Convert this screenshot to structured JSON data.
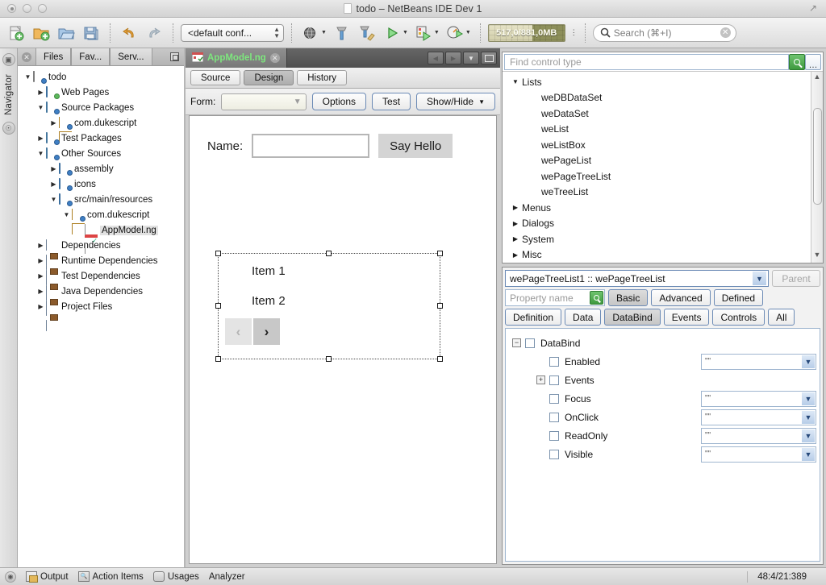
{
  "window": {
    "title": "todo – NetBeans IDE Dev 1",
    "traffic_lights": [
      "close",
      "minimize",
      "zoom"
    ]
  },
  "toolbar": {
    "items": [
      {
        "name": "new-file-icon",
        "label": "New File"
      },
      {
        "name": "new-project-icon",
        "label": "New Project"
      },
      {
        "name": "open-project-icon",
        "label": "Open Project"
      },
      {
        "name": "save-all-icon",
        "label": "Save All"
      },
      {
        "name": "undo-icon",
        "label": "Undo"
      },
      {
        "name": "redo-icon",
        "label": "Redo"
      }
    ],
    "config_combo": "<default conf...",
    "run_group": [
      {
        "name": "set-browser-icon",
        "label": "Set Browser"
      },
      {
        "name": "build-project-icon",
        "label": "Build Project"
      },
      {
        "name": "clean-build-icon",
        "label": "Clean and Build Project"
      },
      {
        "name": "run-project-icon",
        "label": "Run Project"
      },
      {
        "name": "debug-project-icon",
        "label": "Debug Project"
      },
      {
        "name": "profile-project-icon",
        "label": "Profile Project"
      }
    ],
    "memory": "517,0/881,0MB",
    "search_placeholder": "Search (⌘+I)"
  },
  "left_strip": {
    "tabs": [
      "Navigator"
    ]
  },
  "projects_window": {
    "tabs": [
      {
        "label": "Files",
        "active": false
      },
      {
        "label": "Fav...",
        "active": false
      },
      {
        "label": "Serv...",
        "active": false
      }
    ],
    "tree": [
      {
        "indent": 0,
        "twisty": "down",
        "icon": "java-project-icon",
        "label": "todo"
      },
      {
        "indent": 1,
        "twisty": "right",
        "icon": "web-pages-folder-icon",
        "label": "Web Pages"
      },
      {
        "indent": 1,
        "twisty": "down",
        "icon": "source-packages-icon",
        "label": "Source Packages"
      },
      {
        "indent": 2,
        "twisty": "right",
        "icon": "package-icon",
        "label": "com.dukescript"
      },
      {
        "indent": 1,
        "twisty": "right",
        "icon": "test-packages-icon",
        "label": "Test Packages"
      },
      {
        "indent": 1,
        "twisty": "down",
        "icon": "other-sources-icon",
        "label": "Other Sources"
      },
      {
        "indent": 2,
        "twisty": "right",
        "icon": "folder-icon",
        "label": "assembly"
      },
      {
        "indent": 2,
        "twisty": "right",
        "icon": "folder-icon",
        "label": "icons"
      },
      {
        "indent": 2,
        "twisty": "down",
        "icon": "folder-icon",
        "label": "src/main/resources"
      },
      {
        "indent": 3,
        "twisty": "down",
        "icon": "package-icon",
        "label": "com.dukescript"
      },
      {
        "indent": 4,
        "twisty": "none",
        "icon": "ng-file-icon",
        "label": "AppModel.ng",
        "selected": true
      },
      {
        "indent": 1,
        "twisty": "right",
        "icon": "libraries-icon",
        "label": "Dependencies"
      },
      {
        "indent": 1,
        "twisty": "right",
        "icon": "libraries-icon",
        "label": "Runtime Dependencies"
      },
      {
        "indent": 1,
        "twisty": "right",
        "icon": "libraries-icon",
        "label": "Test Dependencies"
      },
      {
        "indent": 1,
        "twisty": "right",
        "icon": "libraries-icon",
        "label": "Java Dependencies"
      },
      {
        "indent": 1,
        "twisty": "right",
        "icon": "project-files-icon",
        "label": "Project Files"
      }
    ]
  },
  "editor": {
    "tab": {
      "label": "AppModel.ng",
      "close": "×"
    },
    "nav_buttons": [
      "◀",
      "▶",
      "▼",
      "maximize"
    ],
    "modes": [
      {
        "label": "Source",
        "active": false
      },
      {
        "label": "Design",
        "active": true
      },
      {
        "label": "History",
        "active": false
      }
    ],
    "formbar": {
      "form_label": "Form:",
      "form_value": "",
      "buttons": [
        {
          "label": "Options",
          "dropdown": false
        },
        {
          "label": "Test",
          "dropdown": false
        },
        {
          "label": "Show/Hide",
          "dropdown": true
        }
      ]
    },
    "canvas": {
      "name_label": "Name:",
      "name_value": "",
      "say_hello_label": "Say Hello",
      "list_items": [
        "Item 1",
        "Item 2"
      ],
      "pager": {
        "prev": "‹",
        "next": "›"
      }
    }
  },
  "palette": {
    "search_placeholder": "Find control type",
    "nodes": [
      {
        "level": "group",
        "twisty": "down",
        "label": "Lists"
      },
      {
        "level": "child",
        "twisty": "none",
        "label": "weDBDataSet"
      },
      {
        "level": "child",
        "twisty": "none",
        "label": "weDataSet"
      },
      {
        "level": "child",
        "twisty": "none",
        "label": "weList"
      },
      {
        "level": "child",
        "twisty": "none",
        "label": "weListBox"
      },
      {
        "level": "child",
        "twisty": "none",
        "label": "wePageList"
      },
      {
        "level": "child",
        "twisty": "none",
        "label": "wePageTreeList"
      },
      {
        "level": "child",
        "twisty": "none",
        "label": "weTreeList"
      },
      {
        "level": "group",
        "twisty": "right",
        "label": "Menus"
      },
      {
        "level": "group",
        "twisty": "right",
        "label": "Dialogs"
      },
      {
        "level": "group",
        "twisty": "right",
        "label": "System"
      },
      {
        "level": "group",
        "twisty": "right",
        "label": "Misc"
      }
    ]
  },
  "properties": {
    "object_combo": "wePageTreeList1 :: wePageTreeList",
    "parent_button": "Parent",
    "property_name_placeholder": "Property name",
    "filter_buttons": [
      {
        "label": "Basic",
        "active": true
      },
      {
        "label": "Advanced",
        "active": false
      },
      {
        "label": "Defined",
        "active": false
      }
    ],
    "category_tabs": [
      {
        "label": "Definition",
        "active": false
      },
      {
        "label": "Data",
        "active": false
      },
      {
        "label": "DataBind",
        "active": true
      },
      {
        "label": "Events",
        "active": false
      },
      {
        "label": "Controls",
        "active": false
      },
      {
        "label": "All",
        "active": false
      }
    ],
    "rows": [
      {
        "level": 0,
        "expander": "minus",
        "label": "DataBind",
        "checked": false,
        "value": null
      },
      {
        "level": 1,
        "expander": "none",
        "label": "Enabled",
        "checked": false,
        "value": "\"\""
      },
      {
        "level": 1,
        "expander": "plus",
        "label": "Events",
        "checked": false,
        "value": null
      },
      {
        "level": 1,
        "expander": "none",
        "label": "Focus",
        "checked": false,
        "value": "\"\""
      },
      {
        "level": 1,
        "expander": "none",
        "label": "OnClick",
        "checked": false,
        "value": "\"\""
      },
      {
        "level": 1,
        "expander": "none",
        "label": "ReadOnly",
        "checked": false,
        "value": "\"\""
      },
      {
        "level": 1,
        "expander": "none",
        "label": "Visible",
        "checked": false,
        "value": "\"\""
      }
    ]
  },
  "statusbar": {
    "items": [
      "Output",
      "Action Items",
      "Usages",
      "Analyzer"
    ],
    "position": "48:4/21:389"
  },
  "colors": {
    "accent_green": "#7ee77e",
    "memory_bar": "#8d8f5a",
    "selection_blue": "#6b8ab5"
  }
}
